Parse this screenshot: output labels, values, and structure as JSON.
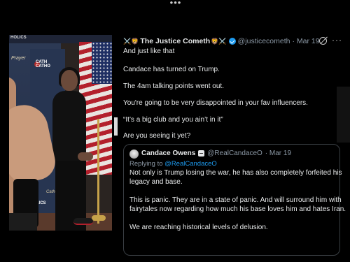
{
  "tweet": {
    "author_emoji_left": "⚔️🦁",
    "author_name": "The Justice Cometh",
    "author_emoji_right": "🦁⚔️",
    "handle": "@justicecometh",
    "date": "· Mar 19",
    "lines": [
      "And just like that",
      "Candace has turned on Trump.",
      "The 4am talking points went out.",
      "You're going to be very disappointed in your fav influencers.",
      "“It’s a big club and you ain’t in it”",
      "Are you seeing it yet?"
    ]
  },
  "quote": {
    "author_name": "Candace Owens",
    "handle": "@RealCandaceO",
    "date": "· Mar 19",
    "replying_prefix": "Replying to",
    "replying_handle": "@RealCandaceO",
    "lines": [
      "Not only is Trump losing the war, he has also completely forfeited his",
      "legacy and base.",
      "This is panic. They are in a state of panic. And will surround him with",
      "fairytales now regarding how much his base loves him and hates Iran.",
      "We are reaching historical levels of delusion."
    ]
  },
  "photo": {
    "strip_left": "HOLICS",
    "logo_prayer": "Prayer",
    "logo_catholics": "CATH\nCATHO",
    "logo_bottom": "CATHOLICS",
    "logo_script": "Catholic"
  },
  "icons": {
    "top_menu": "more-dots-icon",
    "verified": "verified-badge-icon",
    "grok": "grok-icon",
    "more": "more-icon"
  },
  "colors": {
    "background": "#000000",
    "text": "#e7e9ea",
    "muted": "#8b98a5",
    "link": "#1d9bf0",
    "border": "#3a3f44"
  }
}
